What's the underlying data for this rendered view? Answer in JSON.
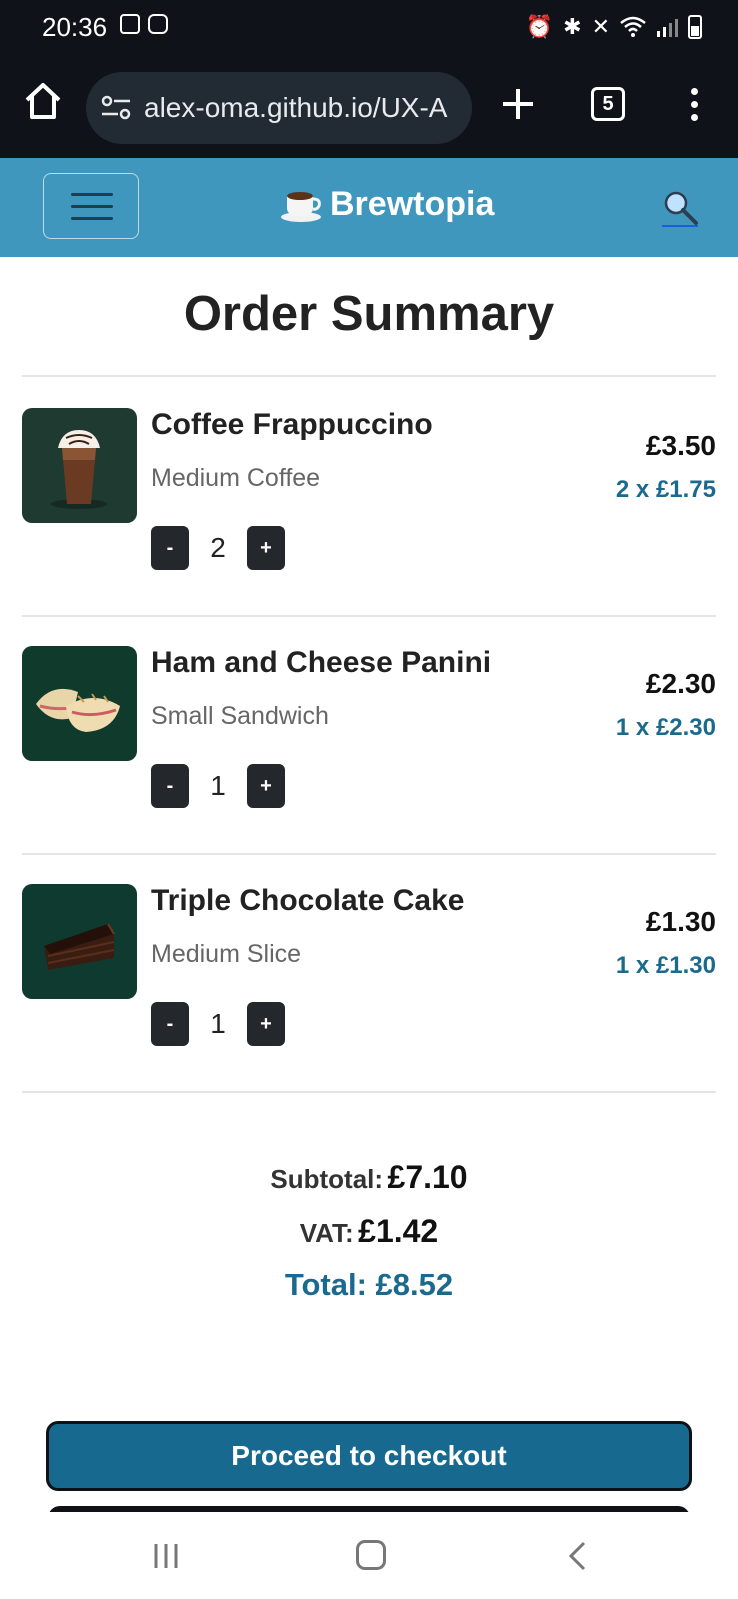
{
  "status_bar": {
    "time": "20:36"
  },
  "browser": {
    "url": "alex-oma.github.io/UX-A",
    "tab_count": "5"
  },
  "app": {
    "brand": "Brewtopia"
  },
  "page": {
    "title": "Order Summary"
  },
  "items": [
    {
      "name": "Coffee Frappuccino",
      "desc": "Medium Coffee",
      "qty": "2",
      "price": "£3.50",
      "unit": "2 x £1.75",
      "dec": "-",
      "inc": "+"
    },
    {
      "name": "Ham and Cheese Panini",
      "desc": "Small Sandwich",
      "qty": "1",
      "price": "£2.30",
      "unit": "1 x £2.30",
      "dec": "-",
      "inc": "+"
    },
    {
      "name": "Triple Chocolate Cake",
      "desc": "Medium Slice",
      "qty": "1",
      "price": "£1.30",
      "unit": "1 x £1.30",
      "dec": "-",
      "inc": "+"
    }
  ],
  "totals": {
    "subtotal_label": "Subtotal:",
    "subtotal": "£7.10",
    "vat_label": "VAT:",
    "vat": "£1.42",
    "total": "Total: £8.52"
  },
  "actions": {
    "checkout_label": "Proceed to checkout"
  },
  "colors": {
    "navbar": "#3f97be",
    "accent": "#1b6a8e",
    "checkout": "#17698f",
    "thumb_bg": "#0f3a2f"
  }
}
